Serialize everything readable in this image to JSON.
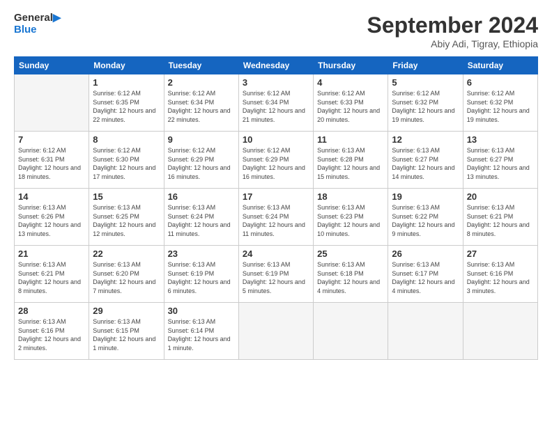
{
  "header": {
    "logo_general": "General",
    "logo_blue": "Blue",
    "month_title": "September 2024",
    "subtitle": "Abiy Adi, Tigray, Ethiopia"
  },
  "weekdays": [
    "Sunday",
    "Monday",
    "Tuesday",
    "Wednesday",
    "Thursday",
    "Friday",
    "Saturday"
  ],
  "days": [
    {
      "day": "",
      "sunrise": "",
      "sunset": "",
      "daylight": "",
      "empty": true
    },
    {
      "day": "1",
      "sunrise": "Sunrise: 6:12 AM",
      "sunset": "Sunset: 6:35 PM",
      "daylight": "Daylight: 12 hours and 22 minutes.",
      "empty": false
    },
    {
      "day": "2",
      "sunrise": "Sunrise: 6:12 AM",
      "sunset": "Sunset: 6:34 PM",
      "daylight": "Daylight: 12 hours and 22 minutes.",
      "empty": false
    },
    {
      "day": "3",
      "sunrise": "Sunrise: 6:12 AM",
      "sunset": "Sunset: 6:34 PM",
      "daylight": "Daylight: 12 hours and 21 minutes.",
      "empty": false
    },
    {
      "day": "4",
      "sunrise": "Sunrise: 6:12 AM",
      "sunset": "Sunset: 6:33 PM",
      "daylight": "Daylight: 12 hours and 20 minutes.",
      "empty": false
    },
    {
      "day": "5",
      "sunrise": "Sunrise: 6:12 AM",
      "sunset": "Sunset: 6:32 PM",
      "daylight": "Daylight: 12 hours and 19 minutes.",
      "empty": false
    },
    {
      "day": "6",
      "sunrise": "Sunrise: 6:12 AM",
      "sunset": "Sunset: 6:32 PM",
      "daylight": "Daylight: 12 hours and 19 minutes.",
      "empty": false
    },
    {
      "day": "7",
      "sunrise": "Sunrise: 6:12 AM",
      "sunset": "Sunset: 6:31 PM",
      "daylight": "Daylight: 12 hours and 18 minutes.",
      "empty": false
    },
    {
      "day": "8",
      "sunrise": "Sunrise: 6:12 AM",
      "sunset": "Sunset: 6:30 PM",
      "daylight": "Daylight: 12 hours and 17 minutes.",
      "empty": false
    },
    {
      "day": "9",
      "sunrise": "Sunrise: 6:12 AM",
      "sunset": "Sunset: 6:29 PM",
      "daylight": "Daylight: 12 hours and 16 minutes.",
      "empty": false
    },
    {
      "day": "10",
      "sunrise": "Sunrise: 6:12 AM",
      "sunset": "Sunset: 6:29 PM",
      "daylight": "Daylight: 12 hours and 16 minutes.",
      "empty": false
    },
    {
      "day": "11",
      "sunrise": "Sunrise: 6:13 AM",
      "sunset": "Sunset: 6:28 PM",
      "daylight": "Daylight: 12 hours and 15 minutes.",
      "empty": false
    },
    {
      "day": "12",
      "sunrise": "Sunrise: 6:13 AM",
      "sunset": "Sunset: 6:27 PM",
      "daylight": "Daylight: 12 hours and 14 minutes.",
      "empty": false
    },
    {
      "day": "13",
      "sunrise": "Sunrise: 6:13 AM",
      "sunset": "Sunset: 6:27 PM",
      "daylight": "Daylight: 12 hours and 13 minutes.",
      "empty": false
    },
    {
      "day": "14",
      "sunrise": "Sunrise: 6:13 AM",
      "sunset": "Sunset: 6:26 PM",
      "daylight": "Daylight: 12 hours and 13 minutes.",
      "empty": false
    },
    {
      "day": "15",
      "sunrise": "Sunrise: 6:13 AM",
      "sunset": "Sunset: 6:25 PM",
      "daylight": "Daylight: 12 hours and 12 minutes.",
      "empty": false
    },
    {
      "day": "16",
      "sunrise": "Sunrise: 6:13 AM",
      "sunset": "Sunset: 6:24 PM",
      "daylight": "Daylight: 12 hours and 11 minutes.",
      "empty": false
    },
    {
      "day": "17",
      "sunrise": "Sunrise: 6:13 AM",
      "sunset": "Sunset: 6:24 PM",
      "daylight": "Daylight: 12 hours and 11 minutes.",
      "empty": false
    },
    {
      "day": "18",
      "sunrise": "Sunrise: 6:13 AM",
      "sunset": "Sunset: 6:23 PM",
      "daylight": "Daylight: 12 hours and 10 minutes.",
      "empty": false
    },
    {
      "day": "19",
      "sunrise": "Sunrise: 6:13 AM",
      "sunset": "Sunset: 6:22 PM",
      "daylight": "Daylight: 12 hours and 9 minutes.",
      "empty": false
    },
    {
      "day": "20",
      "sunrise": "Sunrise: 6:13 AM",
      "sunset": "Sunset: 6:21 PM",
      "daylight": "Daylight: 12 hours and 8 minutes.",
      "empty": false
    },
    {
      "day": "21",
      "sunrise": "Sunrise: 6:13 AM",
      "sunset": "Sunset: 6:21 PM",
      "daylight": "Daylight: 12 hours and 8 minutes.",
      "empty": false
    },
    {
      "day": "22",
      "sunrise": "Sunrise: 6:13 AM",
      "sunset": "Sunset: 6:20 PM",
      "daylight": "Daylight: 12 hours and 7 minutes.",
      "empty": false
    },
    {
      "day": "23",
      "sunrise": "Sunrise: 6:13 AM",
      "sunset": "Sunset: 6:19 PM",
      "daylight": "Daylight: 12 hours and 6 minutes.",
      "empty": false
    },
    {
      "day": "24",
      "sunrise": "Sunrise: 6:13 AM",
      "sunset": "Sunset: 6:19 PM",
      "daylight": "Daylight: 12 hours and 5 minutes.",
      "empty": false
    },
    {
      "day": "25",
      "sunrise": "Sunrise: 6:13 AM",
      "sunset": "Sunset: 6:18 PM",
      "daylight": "Daylight: 12 hours and 4 minutes.",
      "empty": false
    },
    {
      "day": "26",
      "sunrise": "Sunrise: 6:13 AM",
      "sunset": "Sunset: 6:17 PM",
      "daylight": "Daylight: 12 hours and 4 minutes.",
      "empty": false
    },
    {
      "day": "27",
      "sunrise": "Sunrise: 6:13 AM",
      "sunset": "Sunset: 6:16 PM",
      "daylight": "Daylight: 12 hours and 3 minutes.",
      "empty": false
    },
    {
      "day": "28",
      "sunrise": "Sunrise: 6:13 AM",
      "sunset": "Sunset: 6:16 PM",
      "daylight": "Daylight: 12 hours and 2 minutes.",
      "empty": false
    },
    {
      "day": "29",
      "sunrise": "Sunrise: 6:13 AM",
      "sunset": "Sunset: 6:15 PM",
      "daylight": "Daylight: 12 hours and 1 minute.",
      "empty": false
    },
    {
      "day": "30",
      "sunrise": "Sunrise: 6:13 AM",
      "sunset": "Sunset: 6:14 PM",
      "daylight": "Daylight: 12 hours and 1 minute.",
      "empty": false
    },
    {
      "day": "",
      "sunrise": "",
      "sunset": "",
      "daylight": "",
      "empty": true
    },
    {
      "day": "",
      "sunrise": "",
      "sunset": "",
      "daylight": "",
      "empty": true
    },
    {
      "day": "",
      "sunrise": "",
      "sunset": "",
      "daylight": "",
      "empty": true
    },
    {
      "day": "",
      "sunrise": "",
      "sunset": "",
      "daylight": "",
      "empty": true
    },
    {
      "day": "",
      "sunrise": "",
      "sunset": "",
      "daylight": "",
      "empty": true
    }
  ]
}
